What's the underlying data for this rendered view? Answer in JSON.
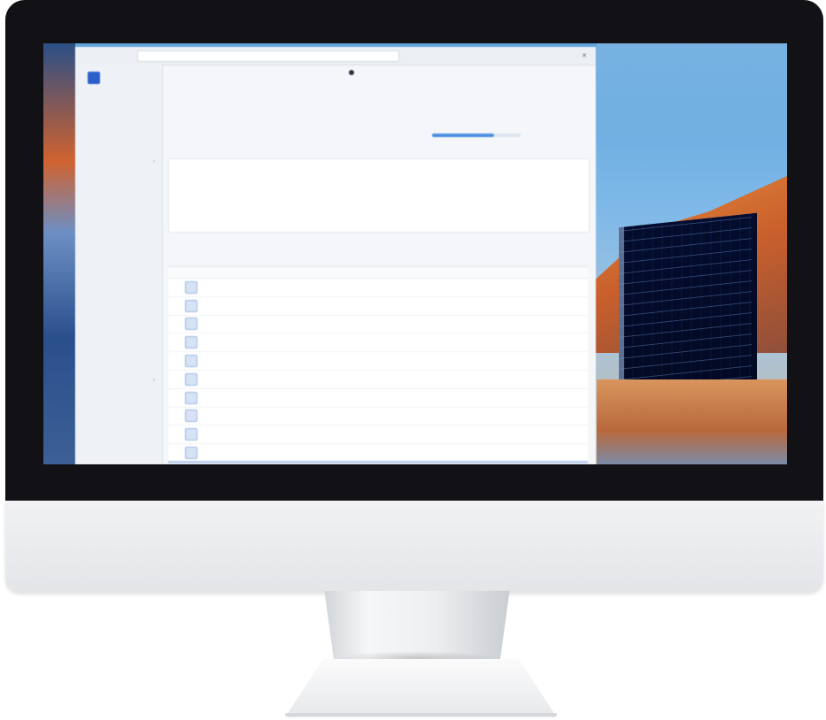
{
  "window": {
    "title": "",
    "url": "",
    "toolbar_buttons": [
      "",
      "",
      "",
      "",
      "",
      ""
    ]
  },
  "sidebar": {
    "items": [
      {
        "label": ""
      },
      {
        "label": ""
      },
      {
        "label": ""
      },
      {
        "label": ""
      },
      {
        "label": "",
        "chevron": true
      },
      {
        "label": ""
      },
      {
        "label": ""
      },
      {
        "label": ""
      },
      {
        "label": ""
      },
      {
        "label": ""
      },
      {
        "label": ""
      },
      {
        "label": ""
      },
      {
        "label": ""
      },
      {
        "label": ""
      },
      {
        "label": ""
      },
      {
        "label": ""
      },
      {
        "label": ""
      },
      {
        "label": ""
      },
      {
        "label": "",
        "chevron": true
      },
      {
        "label": ""
      },
      {
        "label": ""
      },
      {
        "label": ""
      },
      {
        "label": ""
      },
      {
        "label": ""
      },
      {
        "label": "",
        "chevron": true
      },
      {
        "label": ""
      },
      {
        "label": ""
      }
    ]
  },
  "main": {
    "breadcrumb": "",
    "sub_breadcrumb": "",
    "timeline": [
      "",
      "",
      "",
      "",
      "",
      "",
      "",
      "",
      "",
      "",
      ""
    ],
    "summary": {
      "col1_key": "",
      "col1_val": "",
      "col2_key": "",
      "col2_val": "",
      "col3_key": "",
      "col4_key": "",
      "col5_key": "",
      "progress": 0.7
    },
    "card": {
      "title": "",
      "line1": "",
      "line2": "",
      "line3": "",
      "right1": "",
      "right2": "",
      "right2_red": "",
      "right3": "",
      "right_label1": "",
      "right_label2": ""
    },
    "table_title": "",
    "columns": [
      "",
      "",
      "",
      "",
      "",
      "",
      "",
      "",
      "",
      "",
      "",
      "",
      ""
    ],
    "rows": [
      [
        "",
        "",
        "",
        "",
        "",
        "",
        "",
        "",
        "",
        "",
        "",
        "",
        ""
      ],
      [
        "",
        "",
        "",
        "",
        "",
        "",
        "",
        "",
        "",
        "",
        "",
        "",
        ""
      ],
      [
        "",
        "",
        "",
        "",
        "",
        "",
        "",
        "",
        "",
        "",
        "",
        "",
        ""
      ],
      [
        "",
        "",
        "",
        "",
        "",
        "",
        "",
        "",
        "",
        "",
        "",
        "",
        ""
      ],
      [
        "",
        "",
        "",
        "",
        "",
        "",
        "",
        "",
        "",
        "",
        "",
        "",
        ""
      ],
      [
        "",
        "",
        "",
        "",
        "",
        "",
        "",
        "",
        "",
        "",
        "",
        "",
        ""
      ],
      [
        "",
        "",
        "",
        "",
        "",
        "",
        "",
        "",
        "",
        "",
        "",
        "",
        ""
      ],
      [
        "",
        "",
        "",
        "",
        "",
        "",
        "",
        "",
        "",
        "",
        "",
        "",
        ""
      ],
      [
        "",
        "",
        "",
        "",
        "",
        "",
        "",
        "",
        "",
        "",
        "",
        "",
        ""
      ],
      [
        "",
        "",
        "",
        "",
        "",
        "",
        "",
        "",
        "",
        "",
        "",
        "",
        ""
      ],
      [
        "",
        "",
        "",
        "",
        "",
        "",
        "",
        "",
        "",
        "",
        "",
        "",
        ""
      ]
    ]
  },
  "colors": {
    "accent": "#2b5fc9",
    "progress": "#4a8fe0",
    "alert": "#d9534f",
    "bezel": "#121216"
  }
}
